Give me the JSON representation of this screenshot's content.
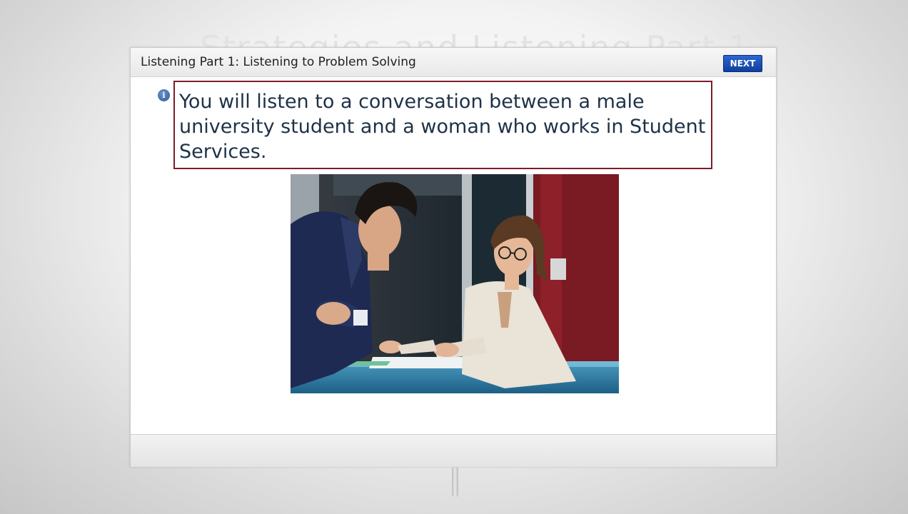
{
  "background": {
    "title_text": "Strategies and Listening Part 1"
  },
  "window": {
    "title": "Listening Part 1: Listening to Problem Solving",
    "next_label": "NEXT"
  },
  "content": {
    "info_icon": "info-icon",
    "prompt": "You will listen to a conversation between a male university student and a woman who works in Student Services.",
    "photo": "photo of a male student talking with a woman at a service desk"
  },
  "colors": {
    "next_button": "#1a4fb5",
    "prompt_border": "#7d1c2a",
    "prompt_text": "#1e3247"
  }
}
